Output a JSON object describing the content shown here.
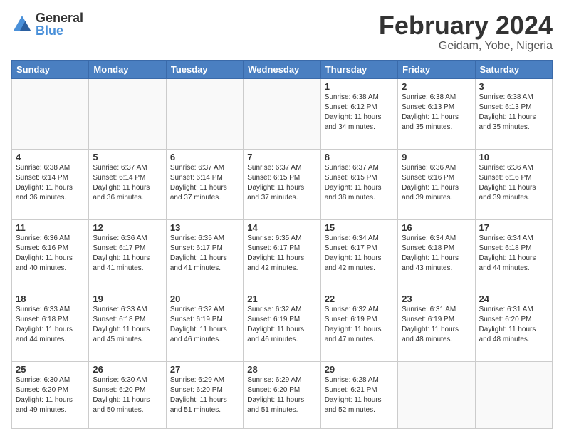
{
  "header": {
    "logo_general": "General",
    "logo_blue": "Blue",
    "main_title": "February 2024",
    "subtitle": "Geidam, Yobe, Nigeria"
  },
  "days_of_week": [
    "Sunday",
    "Monday",
    "Tuesday",
    "Wednesday",
    "Thursday",
    "Friday",
    "Saturday"
  ],
  "weeks": [
    [
      {
        "day": "",
        "info": ""
      },
      {
        "day": "",
        "info": ""
      },
      {
        "day": "",
        "info": ""
      },
      {
        "day": "",
        "info": ""
      },
      {
        "day": "1",
        "info": "Sunrise: 6:38 AM\nSunset: 6:12 PM\nDaylight: 11 hours and 34 minutes."
      },
      {
        "day": "2",
        "info": "Sunrise: 6:38 AM\nSunset: 6:13 PM\nDaylight: 11 hours and 35 minutes."
      },
      {
        "day": "3",
        "info": "Sunrise: 6:38 AM\nSunset: 6:13 PM\nDaylight: 11 hours and 35 minutes."
      }
    ],
    [
      {
        "day": "4",
        "info": "Sunrise: 6:38 AM\nSunset: 6:14 PM\nDaylight: 11 hours and 36 minutes."
      },
      {
        "day": "5",
        "info": "Sunrise: 6:37 AM\nSunset: 6:14 PM\nDaylight: 11 hours and 36 minutes."
      },
      {
        "day": "6",
        "info": "Sunrise: 6:37 AM\nSunset: 6:14 PM\nDaylight: 11 hours and 37 minutes."
      },
      {
        "day": "7",
        "info": "Sunrise: 6:37 AM\nSunset: 6:15 PM\nDaylight: 11 hours and 37 minutes."
      },
      {
        "day": "8",
        "info": "Sunrise: 6:37 AM\nSunset: 6:15 PM\nDaylight: 11 hours and 38 minutes."
      },
      {
        "day": "9",
        "info": "Sunrise: 6:36 AM\nSunset: 6:16 PM\nDaylight: 11 hours and 39 minutes."
      },
      {
        "day": "10",
        "info": "Sunrise: 6:36 AM\nSunset: 6:16 PM\nDaylight: 11 hours and 39 minutes."
      }
    ],
    [
      {
        "day": "11",
        "info": "Sunrise: 6:36 AM\nSunset: 6:16 PM\nDaylight: 11 hours and 40 minutes."
      },
      {
        "day": "12",
        "info": "Sunrise: 6:36 AM\nSunset: 6:17 PM\nDaylight: 11 hours and 41 minutes."
      },
      {
        "day": "13",
        "info": "Sunrise: 6:35 AM\nSunset: 6:17 PM\nDaylight: 11 hours and 41 minutes."
      },
      {
        "day": "14",
        "info": "Sunrise: 6:35 AM\nSunset: 6:17 PM\nDaylight: 11 hours and 42 minutes."
      },
      {
        "day": "15",
        "info": "Sunrise: 6:34 AM\nSunset: 6:17 PM\nDaylight: 11 hours and 42 minutes."
      },
      {
        "day": "16",
        "info": "Sunrise: 6:34 AM\nSunset: 6:18 PM\nDaylight: 11 hours and 43 minutes."
      },
      {
        "day": "17",
        "info": "Sunrise: 6:34 AM\nSunset: 6:18 PM\nDaylight: 11 hours and 44 minutes."
      }
    ],
    [
      {
        "day": "18",
        "info": "Sunrise: 6:33 AM\nSunset: 6:18 PM\nDaylight: 11 hours and 44 minutes."
      },
      {
        "day": "19",
        "info": "Sunrise: 6:33 AM\nSunset: 6:18 PM\nDaylight: 11 hours and 45 minutes."
      },
      {
        "day": "20",
        "info": "Sunrise: 6:32 AM\nSunset: 6:19 PM\nDaylight: 11 hours and 46 minutes."
      },
      {
        "day": "21",
        "info": "Sunrise: 6:32 AM\nSunset: 6:19 PM\nDaylight: 11 hours and 46 minutes."
      },
      {
        "day": "22",
        "info": "Sunrise: 6:32 AM\nSunset: 6:19 PM\nDaylight: 11 hours and 47 minutes."
      },
      {
        "day": "23",
        "info": "Sunrise: 6:31 AM\nSunset: 6:19 PM\nDaylight: 11 hours and 48 minutes."
      },
      {
        "day": "24",
        "info": "Sunrise: 6:31 AM\nSunset: 6:20 PM\nDaylight: 11 hours and 48 minutes."
      }
    ],
    [
      {
        "day": "25",
        "info": "Sunrise: 6:30 AM\nSunset: 6:20 PM\nDaylight: 11 hours and 49 minutes."
      },
      {
        "day": "26",
        "info": "Sunrise: 6:30 AM\nSunset: 6:20 PM\nDaylight: 11 hours and 50 minutes."
      },
      {
        "day": "27",
        "info": "Sunrise: 6:29 AM\nSunset: 6:20 PM\nDaylight: 11 hours and 51 minutes."
      },
      {
        "day": "28",
        "info": "Sunrise: 6:29 AM\nSunset: 6:20 PM\nDaylight: 11 hours and 51 minutes."
      },
      {
        "day": "29",
        "info": "Sunrise: 6:28 AM\nSunset: 6:21 PM\nDaylight: 11 hours and 52 minutes."
      },
      {
        "day": "",
        "info": ""
      },
      {
        "day": "",
        "info": ""
      }
    ]
  ]
}
